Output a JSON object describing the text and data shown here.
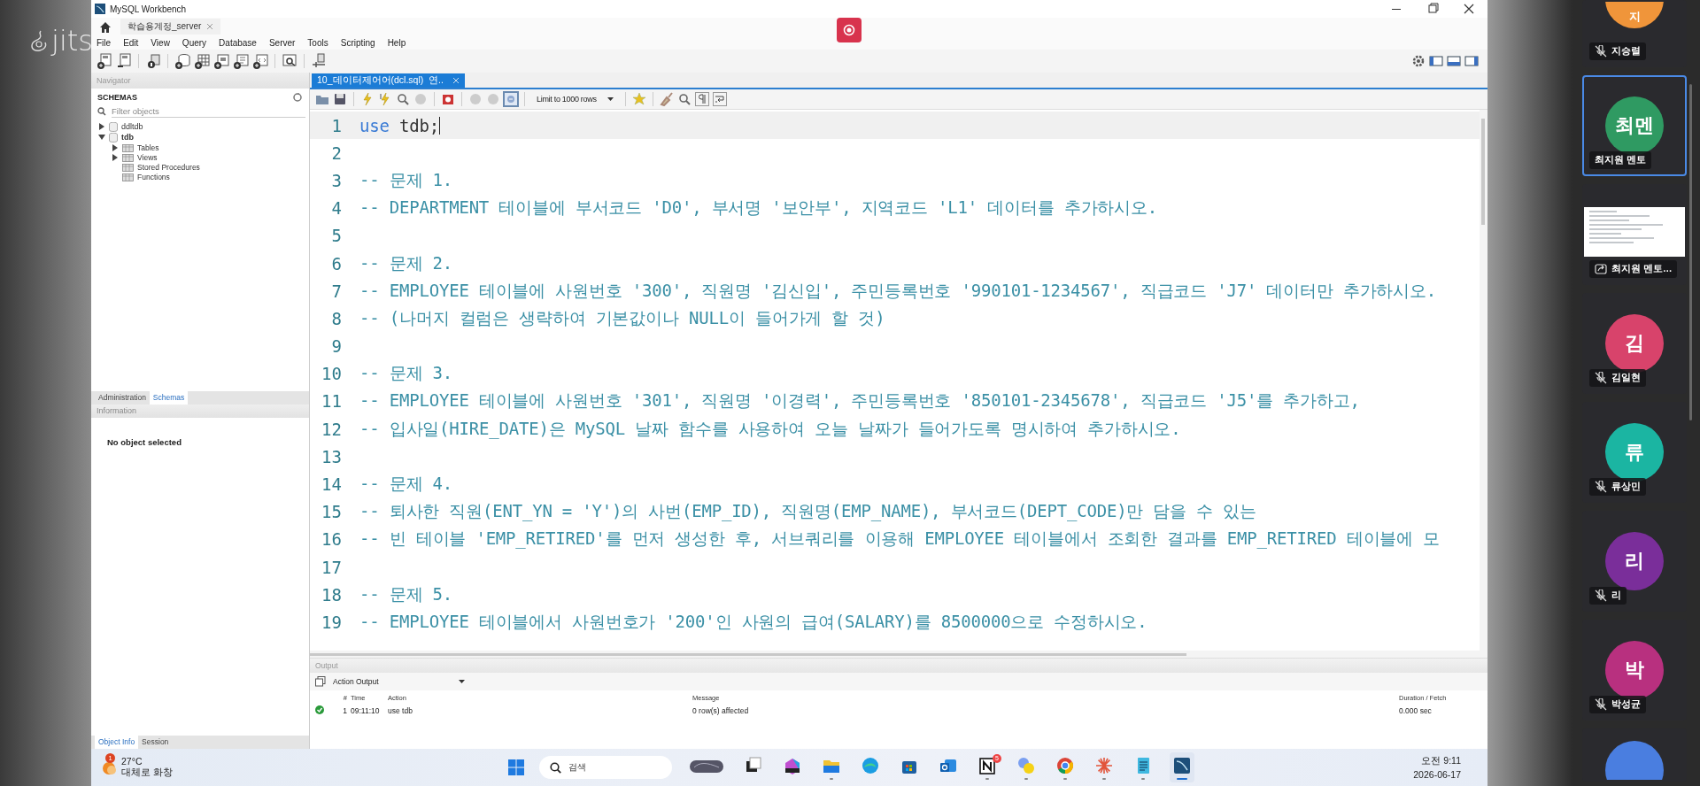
{
  "meeting": {
    "logo_text": "jits"
  },
  "window": {
    "title": "MySQL Workbench",
    "connection_tab": "학습용계정_server",
    "menu": [
      "File",
      "Edit",
      "View",
      "Query",
      "Database",
      "Server",
      "Tools",
      "Scripting",
      "Help"
    ]
  },
  "navigator": {
    "header": "Navigator",
    "schemas_title": "SCHEMAS",
    "filter_placeholder": "Filter objects",
    "tree": [
      {
        "label": "ddltdb",
        "expanded": false,
        "default": false
      },
      {
        "label": "tdb",
        "expanded": true,
        "default": true,
        "children": [
          {
            "label": "Tables",
            "kind": "group",
            "expanded": false
          },
          {
            "label": "Views",
            "kind": "group",
            "expanded": false
          },
          {
            "label": "Stored Procedures",
            "kind": "leaf"
          },
          {
            "label": "Functions",
            "kind": "leaf"
          }
        ]
      }
    ],
    "side_tabs": [
      {
        "label": "Administration",
        "selected": false
      },
      {
        "label": "Schemas",
        "selected": true
      }
    ],
    "information": {
      "header": "Information",
      "text": "No object selected"
    },
    "bottom_tabs": [
      {
        "label": "Object Info",
        "selected": true
      },
      {
        "label": "Session",
        "selected": false
      }
    ]
  },
  "editor": {
    "tab": "10_데이터제어어(dcl.sql)  연..",
    "toggle_pressed": true,
    "limit": "Limit to 1000 rows",
    "lines": [
      {
        "number": "1",
        "current": true,
        "parts": [
          {
            "kind": "keyword",
            "text": "use"
          },
          {
            "kind": "plain",
            "text": " tdb;"
          }
        ]
      },
      {
        "number": "2",
        "current": false
      },
      {
        "number": "3",
        "current": false,
        "parts": [
          {
            "kind": "comment",
            "text": "-- 문제 1."
          }
        ]
      },
      {
        "number": "4",
        "current": false,
        "parts": [
          {
            "kind": "comment",
            "text": "-- DEPARTMENT 테이블에 부서코드 'D0', 부서명 '보안부', 지역코드 'L1' 데이터를 추가하시오."
          }
        ]
      },
      {
        "number": "5",
        "current": false
      },
      {
        "number": "6",
        "current": false,
        "parts": [
          {
            "kind": "comment",
            "text": "-- 문제 2."
          }
        ]
      },
      {
        "number": "7",
        "current": false,
        "parts": [
          {
            "kind": "comment",
            "text": "-- EMPLOYEE 테이블에 사원번호 '300', 직원명 '김신입', 주민등록번호 '990101-1234567', 직급코드 'J7' 데이터만 추가하시오."
          }
        ]
      },
      {
        "number": "8",
        "current": false,
        "parts": [
          {
            "kind": "comment",
            "text": "-- (나머지 컬럼은 생략하여 기본값이나 NULL이 들어가게 할 것)"
          }
        ]
      },
      {
        "number": "9",
        "current": false
      },
      {
        "number": "10",
        "current": false,
        "parts": [
          {
            "kind": "comment",
            "text": "-- 문제 3."
          }
        ]
      },
      {
        "number": "11",
        "current": false,
        "parts": [
          {
            "kind": "comment",
            "text": "-- EMPLOYEE 테이블에 사원번호 '301', 직원명 '이경력', 주민등록번호 '850101-2345678', 직급코드 'J5'를 추가하고,"
          }
        ]
      },
      {
        "number": "12",
        "current": false,
        "parts": [
          {
            "kind": "comment",
            "text": "-- 입사일(HIRE_DATE)은 MySQL 날짜 함수를 사용하여 오늘 날짜가 들어가도록 명시하여 추가하시오."
          }
        ]
      },
      {
        "number": "13",
        "current": false
      },
      {
        "number": "14",
        "current": false,
        "parts": [
          {
            "kind": "comment",
            "text": "-- 문제 4."
          }
        ]
      },
      {
        "number": "15",
        "current": false,
        "parts": [
          {
            "kind": "comment",
            "text": "-- 퇴사한 직원(ENT_YN = 'Y')의 사번(EMP_ID), 직원명(EMP_NAME), 부서코드(DEPT_CODE)만 담을 수 있는"
          }
        ]
      },
      {
        "number": "16",
        "current": false,
        "parts": [
          {
            "kind": "comment",
            "text": "-- 빈 테이블 'EMP_RETIRED'를 먼저 생성한 후, 서브쿼리를 이용해 EMPLOYEE 테이블에서 조회한 결과를 EMP_RETIRED 테이블에 모"
          }
        ]
      },
      {
        "number": "17",
        "current": false
      },
      {
        "number": "18",
        "current": false,
        "parts": [
          {
            "kind": "comment",
            "text": "-- 문제 5."
          }
        ]
      },
      {
        "number": "19",
        "current": false,
        "parts": [
          {
            "kind": "comment",
            "text": "-- EMPLOYEE 테이블에서 사원번호가 '200'인 사원의 급여(SALARY)를 8500000으로 수정하시오."
          }
        ]
      }
    ]
  },
  "output": {
    "header": "Output",
    "selector": "Action Output",
    "columns": [
      "#",
      "Time",
      "Action",
      "Message",
      "Duration / Fetch"
    ],
    "rows": [
      {
        "success": true,
        "number": "1",
        "time": "09:11:10",
        "action": "use tdb",
        "message": "0 row(s) affected",
        "duration": "0.000 sec"
      }
    ]
  },
  "taskbar": {
    "weather": {
      "badge": "1",
      "temperature": "27°C",
      "description": "대체로 화창"
    },
    "search_placeholder": "검색",
    "apps": [
      {
        "kind": "widget",
        "running": false
      },
      {
        "kind": "taskview",
        "running": false
      },
      {
        "kind": "copilot",
        "running": false
      },
      {
        "kind": "explorer",
        "running": true
      },
      {
        "kind": "edge",
        "running": false
      },
      {
        "kind": "store",
        "running": false
      },
      {
        "kind": "outlook",
        "running": false
      },
      {
        "kind": "notion",
        "running": true,
        "badge": "5"
      },
      {
        "kind": "chat",
        "running": true
      },
      {
        "kind": "chrome",
        "running": true
      },
      {
        "kind": "burst",
        "running": true
      },
      {
        "kind": "notepad",
        "running": true
      },
      {
        "kind": "workbench",
        "running": true,
        "active": true
      }
    ],
    "time": "오전 9:11",
    "date": "2026-06-17"
  },
  "participants": [
    {
      "kind": "avatar",
      "initial": "지",
      "name": "지승렬",
      "color": "#f0953a",
      "muted": true,
      "selected": false
    },
    {
      "kind": "avatar",
      "initial": "최멘",
      "name": "최지원 멘토",
      "color": "#2f9a62",
      "muted": false,
      "selected": true
    },
    {
      "kind": "screen",
      "name": "최지원 멘토…",
      "selected": false
    },
    {
      "kind": "avatar",
      "initial": "김",
      "name": "김일현",
      "color": "#d8436b",
      "muted": true,
      "selected": false
    },
    {
      "kind": "avatar",
      "initial": "류",
      "name": "류상민",
      "color": "#1bb5a2",
      "muted": true,
      "selected": false
    },
    {
      "kind": "avatar",
      "initial": "리",
      "name": "리",
      "color": "#7a2e9a",
      "muted": true,
      "selected": false
    },
    {
      "kind": "avatar",
      "initial": "박",
      "name": "박성균",
      "color": "#b8307f",
      "muted": true,
      "selected": false
    },
    {
      "kind": "partial",
      "color": "#4a7ee0",
      "selected": false
    }
  ]
}
